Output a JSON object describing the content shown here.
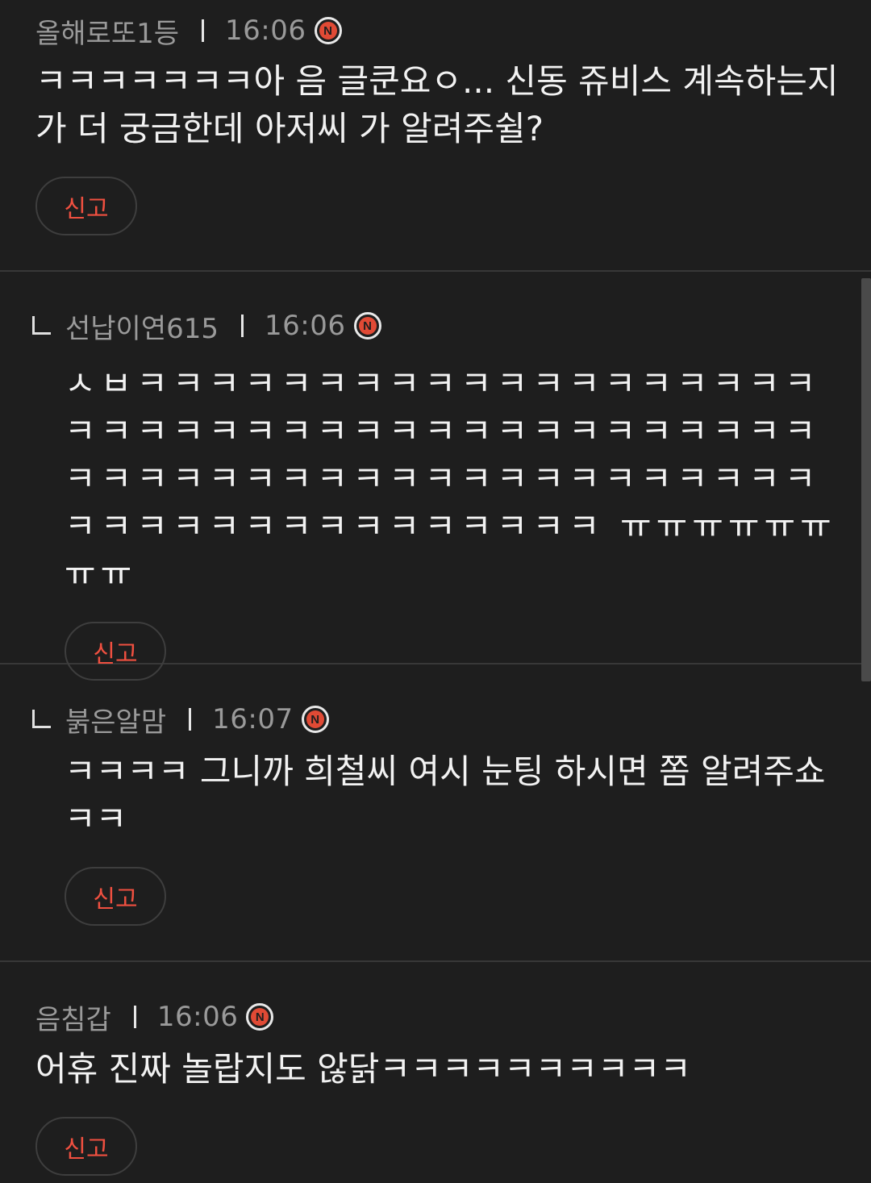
{
  "comments": [
    {
      "author": "올해로또1등",
      "time": "16:06",
      "badge": "N",
      "text": "ㅋㅋㅋㅋㅋㅋㅋ아 음 글쿤요ㅇ... 신동 쥬비스 계속하는지가 더 궁금한데 아저씨 가 알려주쉴?",
      "report_label": "신고"
    },
    {
      "author": "선납이연615",
      "time": "16:06",
      "badge": "N",
      "text": "ㅅㅂㅋㅋㅋㅋㅋㅋㅋㅋㅋㅋㅋㅋㅋㅋㅋㅋㅋㅋㅋㅋㅋㅋㅋㅋㅋㅋㅋㅋㅋㅋㅋㅋㅋㅋㅋㅋㅋㅋㅋㅋㅋㅋㅋㅋㅋㅋㅋㅋㅋㅋㅋㅋㅋㅋㅋㅋㅋㅋㅋㅋㅋㅋㅋㅋㅋㅋㅋㅋㅋㅋㅋㅋㅋㅋㅋㅋ ㅠㅠㅠㅠㅠㅠㅠㅠ",
      "report_label": "신고"
    },
    {
      "author": "붉은알맘",
      "time": "16:07",
      "badge": "N",
      "text": "ㅋㅋㅋㅋ 그니까 희철씨 여시 눈팅 하시면 쫌 알려주쇼 ㅋㅋ",
      "report_label": "신고"
    },
    {
      "author": "음침갑",
      "time": "16:06",
      "badge": "N",
      "text": "어휴 진짜 놀랍지도 않닭ㅋㅋㅋㅋㅋㅋㅋㅋㅋㅋ",
      "report_label": "신고"
    }
  ]
}
